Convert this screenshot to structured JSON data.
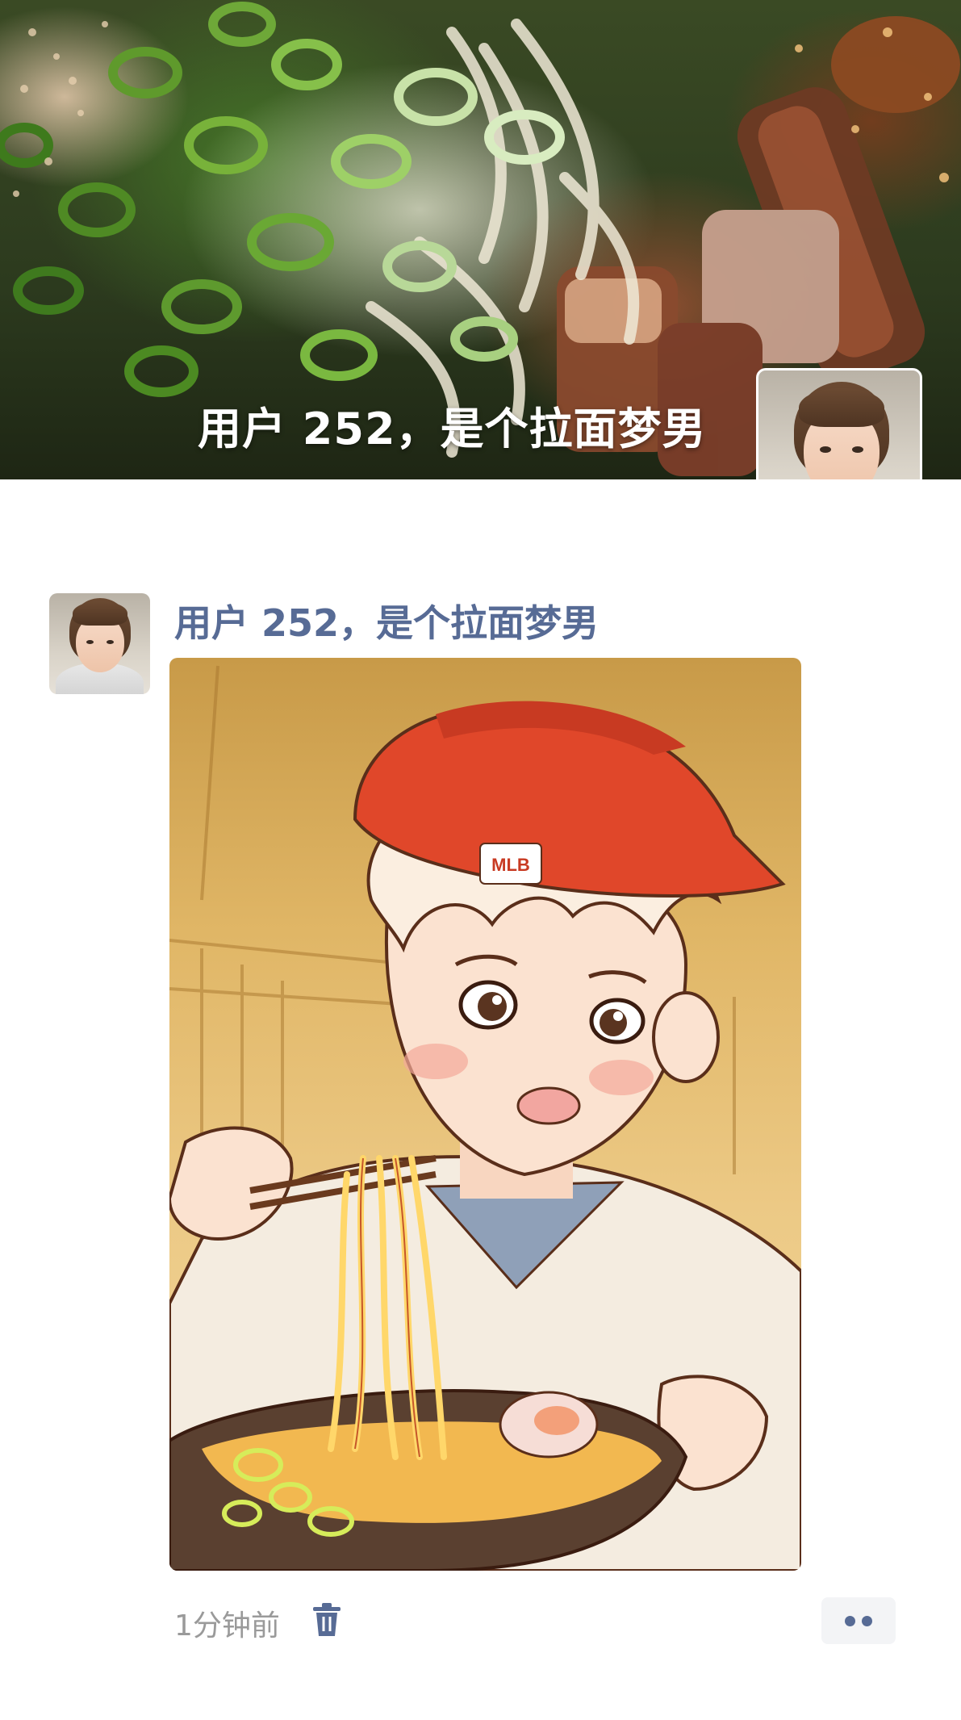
{
  "cover": {
    "title": "用户 252，是个拉面梦男",
    "image_subject": "ramen-with-scallions-and-chashu-photo"
  },
  "post": {
    "author_name": "用户 252，是个拉面梦男",
    "image_subject": "anime-illustration-boy-eating-ramen",
    "cap_logo_text": "MLB",
    "time_ago": "1分钟前"
  },
  "icons": {
    "delete": "trash-icon",
    "more": "more-dots-icon"
  },
  "colors": {
    "link_blue": "#576b95",
    "meta_gray": "#9a9a9a",
    "more_bg": "#f3f4f6"
  }
}
